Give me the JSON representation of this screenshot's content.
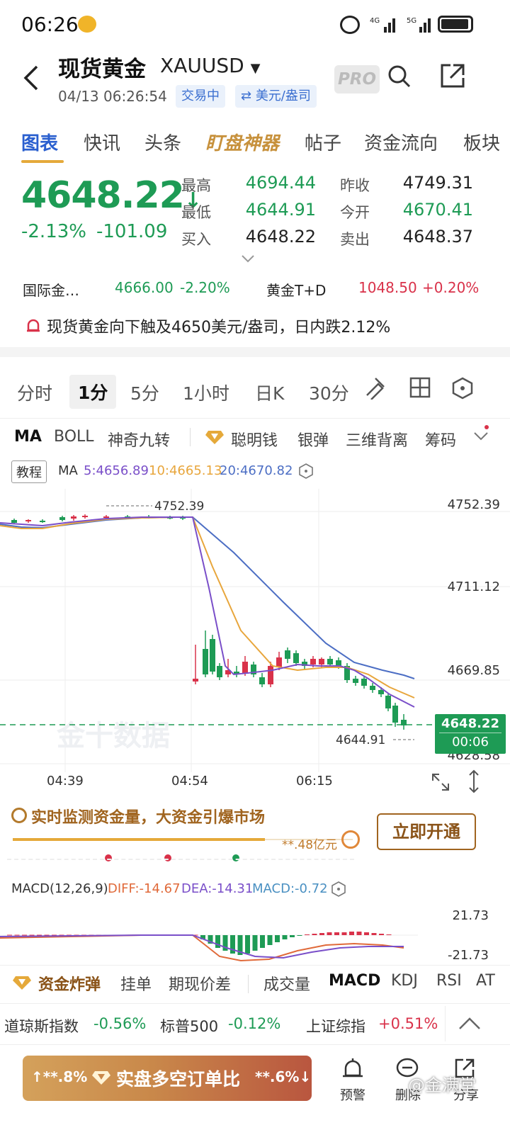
{
  "status_bar": {
    "time": "06:26"
  },
  "header": {
    "title": "现货黄金",
    "symbol": "XAUUSD",
    "datetime": "04/13 06:26:54",
    "trading_status": "交易中",
    "unit": "美元/盎司",
    "pro_label": "PRO"
  },
  "main_tabs": [
    "图表",
    "快讯",
    "头条",
    "盯盘神器",
    "帖子",
    "资金流向",
    "板块"
  ],
  "quote": {
    "price": "4648.22",
    "arrow": "↓",
    "change_pct": "-2.13%",
    "change_abs": "-101.09",
    "high_label": "最高",
    "high": "4694.44",
    "low_label": "最低",
    "low": "4644.91",
    "bid_label": "买入",
    "bid": "4648.22",
    "prev_label": "昨收",
    "prev": "4749.31",
    "open_label": "今开",
    "open": "4670.41",
    "ask_label": "卖出",
    "ask": "4648.37"
  },
  "related": {
    "a_name": "国际金…",
    "a_price": "4666.00",
    "a_pct": "-2.20%",
    "b_name": "黄金T+D",
    "b_price": "1048.50",
    "b_pct": "+0.20%"
  },
  "alert_text": "现货黄金向下触及4650美元/盎司，日内跌2.12%",
  "period_tabs": [
    "分时",
    "1分",
    "5分",
    "1小时",
    "日K",
    "30分"
  ],
  "indicator_tabs": [
    "MA",
    "BOLL",
    "神奇九转",
    "聪明钱",
    "银弹",
    "三维背离",
    "筹码"
  ],
  "ma_legend": {
    "tutorial": "教程",
    "ma": "MA",
    "ma5": "5:4656.89",
    "ma10": "10:4665.13",
    "ma20": "20:4670.82"
  },
  "price_axis": [
    "4752.39",
    "4711.12",
    "4669.85",
    "4628.58"
  ],
  "high_marker": "4752.39",
  "low_marker": "4644.91",
  "current_price": "4648.22",
  "countdown": "00:06",
  "watermark": "金十数据",
  "time_axis": [
    "04:39",
    "04:54",
    "06:15"
  ],
  "promo": {
    "text": "实时监测资金量，大资金引爆市场",
    "amount": "**.48亿元",
    "button": "立即开通"
  },
  "macd": {
    "title": "MACD(12,26,9)",
    "diff": "DIFF:-14.67",
    "dea": "DEA:-14.31",
    "macd": "MACD:-0.72",
    "axis_top": "21.73",
    "axis_bottom": "-21.73"
  },
  "bottom_tabs": [
    "资金炸弹",
    "挂单",
    "期现价差",
    "成交量",
    "MACD",
    "KDJ",
    "RSI",
    "AT"
  ],
  "indices": [
    {
      "name": "道琼斯指数",
      "value": "-0.56%"
    },
    {
      "name": "标普500",
      "value": "-0.12%"
    },
    {
      "name": "上证综指",
      "value": "+0.51%"
    }
  ],
  "bottom_bar": {
    "left_pct": "↑**.8%",
    "center": "实盘多空订单比",
    "right_pct": "**.6%↓",
    "alert_label": "预警",
    "comment_label": "删除",
    "share_label": "分享",
    "overlay_text": "@金满堂"
  },
  "colors": {
    "up": "#d9324a",
    "down": "#1e9b55",
    "accent": "#2a5fcf",
    "ma5": "#7a4fc9",
    "ma10": "#e8a63c",
    "ma20": "#4c6ec4"
  }
}
